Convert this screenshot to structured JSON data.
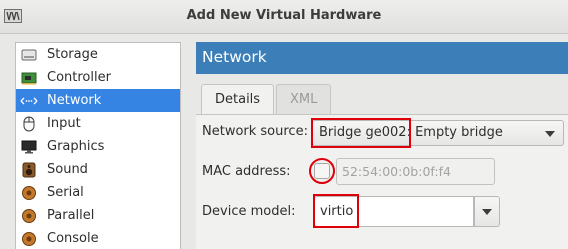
{
  "window": {
    "title": "Add New Virtual Hardware",
    "app_icon": "virt-manager-icon"
  },
  "sidebar": {
    "items": [
      {
        "label": "Storage",
        "icon": "storage-icon",
        "selected": false
      },
      {
        "label": "Controller",
        "icon": "controller-icon",
        "selected": false
      },
      {
        "label": "Network",
        "icon": "network-icon",
        "selected": true
      },
      {
        "label": "Input",
        "icon": "mouse-icon",
        "selected": false
      },
      {
        "label": "Graphics",
        "icon": "monitor-icon",
        "selected": false
      },
      {
        "label": "Sound",
        "icon": "speaker-icon",
        "selected": false
      },
      {
        "label": "Serial",
        "icon": "serial-port-icon",
        "selected": false
      },
      {
        "label": "Parallel",
        "icon": "parallel-port-icon",
        "selected": false
      },
      {
        "label": "Console",
        "icon": "console-icon",
        "selected": false
      }
    ]
  },
  "main": {
    "header": "Network",
    "tabs": [
      {
        "label": "Details",
        "active": true
      },
      {
        "label": "XML",
        "active": false
      }
    ],
    "network_source": {
      "label": "Network source:",
      "value": "Bridge ge002: Empty bridge"
    },
    "mac_address": {
      "label": "MAC address:",
      "checked": false,
      "value": "52:54:00:0b:0f:f4"
    },
    "device_model": {
      "label": "Device model:",
      "value": "virtio"
    }
  },
  "colors": {
    "accent": "#3584e4",
    "header": "#3c7fb8",
    "highlight": "#e0000a"
  }
}
